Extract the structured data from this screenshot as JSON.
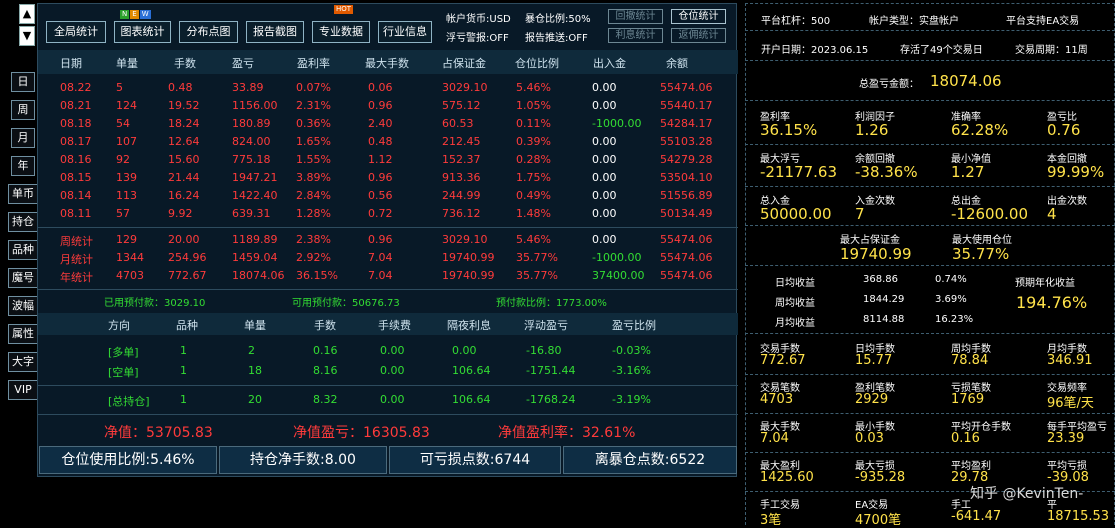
{
  "nav": {
    "up": "▲",
    "down": "▼"
  },
  "side_buttons": [
    "日",
    "周",
    "月",
    "年",
    "单币",
    "持仓",
    "品种",
    "魔号",
    "波幅",
    "属性",
    "大字",
    "VIP"
  ],
  "toolbar": {
    "buttons": [
      "全局统计",
      "图表统计",
      "分布点图",
      "报告截图",
      "专业数据",
      "行业信息"
    ],
    "badges": {
      "new": [
        "N",
        "E",
        "W"
      ],
      "hot": "HOT"
    },
    "account_currency": "帐户货币:USD",
    "exposure_ratio": "暴仓比例:50%",
    "loss_warning": "浮亏警报:OFF",
    "report_push": "报告推送:OFF",
    "small_buttons": [
      "回撤统计",
      "仓位统计",
      "利息统计",
      "返佣统计"
    ],
    "active_small": "仓位统计"
  },
  "table": {
    "headers": [
      "日期",
      "单量",
      "手数",
      "盈亏",
      "盈利率",
      "最大手数",
      "占保证金",
      "仓位比例",
      "出入金",
      "余额"
    ],
    "rows": [
      [
        "08.22",
        "5",
        "0.48",
        "33.89",
        "0.07%",
        "0.06",
        "3029.10",
        "5.46%",
        "0.00",
        "55474.06"
      ],
      [
        "08.21",
        "124",
        "19.52",
        "1156.00",
        "2.31%",
        "0.96",
        "575.12",
        "1.05%",
        "0.00",
        "55440.17"
      ],
      [
        "08.18",
        "54",
        "18.24",
        "180.89",
        "0.36%",
        "2.40",
        "60.53",
        "0.11%",
        "-1000.00",
        "54284.17"
      ],
      [
        "08.17",
        "107",
        "12.64",
        "824.00",
        "1.65%",
        "0.48",
        "212.45",
        "0.39%",
        "0.00",
        "55103.28"
      ],
      [
        "08.16",
        "92",
        "15.60",
        "775.18",
        "1.55%",
        "1.12",
        "152.37",
        "0.28%",
        "0.00",
        "54279.28"
      ],
      [
        "08.15",
        "139",
        "21.44",
        "1947.21",
        "3.89%",
        "0.96",
        "913.36",
        "1.75%",
        "0.00",
        "53504.10"
      ],
      [
        "08.14",
        "113",
        "16.24",
        "1422.40",
        "2.84%",
        "0.56",
        "244.99",
        "0.49%",
        "0.00",
        "51556.89"
      ],
      [
        "08.11",
        "57",
        "9.92",
        "639.31",
        "1.28%",
        "0.72",
        "736.12",
        "1.48%",
        "0.00",
        "50134.49"
      ]
    ],
    "summary": [
      [
        "周统计",
        "129",
        "20.00",
        "1189.89",
        "2.38%",
        "0.96",
        "3029.10",
        "5.46%",
        "0.00",
        "55474.06"
      ],
      [
        "月统计",
        "1344",
        "254.96",
        "1459.04",
        "2.92%",
        "7.04",
        "19740.99",
        "35.77%",
        "-1000.00",
        "55474.06"
      ],
      [
        "年统计",
        "4703",
        "772.67",
        "18074.06",
        "36.15%",
        "7.04",
        "19740.99",
        "35.77%",
        "37400.00",
        "55474.06"
      ]
    ]
  },
  "prepay": {
    "used": "已用预付款：3029.10",
    "available": "可用预付款：50676.73",
    "ratio": "预付款比例：1773.00%"
  },
  "positions": {
    "headers": [
      "方向",
      "品种",
      "单量",
      "手数",
      "手续费",
      "隔夜利息",
      "浮动盈亏",
      "盈亏比例"
    ],
    "rows": [
      [
        "[多单]",
        "1",
        "2",
        "0.16",
        "0.00",
        "0.00",
        "-16.80",
        "-0.03%"
      ],
      [
        "[空单]",
        "1",
        "18",
        "8.16",
        "0.00",
        "106.64",
        "-1751.44",
        "-3.16%"
      ]
    ],
    "total": [
      "[总持仓]",
      "1",
      "20",
      "8.32",
      "0.00",
      "106.64",
      "-1768.24",
      "-3.19%"
    ]
  },
  "net": {
    "value": "净值：53705.83",
    "pl": "净值盈亏：16305.83",
    "rate": "净值盈利率：32.61%"
  },
  "bottom_stats": [
    "仓位使用比例:5.46%",
    "持仓净手数:8.00",
    "可亏损点数:6744",
    "离暴仓点数:6522"
  ],
  "right": {
    "leverage": "平台杠杆：500",
    "account_type": "帐户类型：实盘帐户",
    "ea_support": "平台支持EA交易",
    "open_date": "开户日期：2023.06.15",
    "days": "存活了49个交易日",
    "cycle": "交易周期：11周",
    "total_pl_label": "总盈亏金额：",
    "total_pl_value": "18074.06",
    "grid1": [
      {
        "label": "盈利率",
        "value": "36.15%"
      },
      {
        "label": "利润因子",
        "value": "1.26"
      },
      {
        "label": "准确率",
        "value": "62.28%"
      },
      {
        "label": "盈亏比",
        "value": "0.76"
      },
      {
        "label": "最大浮亏",
        "value": "-21177.63"
      },
      {
        "label": "余额回撤",
        "value": "-38.36%"
      },
      {
        "label": "最小净值",
        "value": "1.27"
      },
      {
        "label": "本金回撤",
        "value": "99.99%"
      },
      {
        "label": "总入金",
        "value": "50000.00"
      },
      {
        "label": "入金次数",
        "value": "7"
      },
      {
        "label": "总出金",
        "value": "-12600.00"
      },
      {
        "label": "出金次数",
        "value": "4"
      }
    ],
    "max_margin_label": "最大占保证金",
    "max_margin_value": "19740.99",
    "max_pos_label": "最大使用仓位",
    "max_pos_value": "35.77%",
    "avg": [
      {
        "label": "日均收益",
        "amount": "368.86",
        "pct": "0.74%"
      },
      {
        "label": "周均收益",
        "amount": "1844.29",
        "pct": "3.69%"
      },
      {
        "label": "月均收益",
        "amount": "8114.88",
        "pct": "16.23%"
      }
    ],
    "annual_label": "预期年化收益",
    "annual_value": "194.76%",
    "grid2": [
      {
        "label": "交易手数",
        "value": "772.67"
      },
      {
        "label": "日均手数",
        "value": "15.77"
      },
      {
        "label": "周均手数",
        "value": "78.84"
      },
      {
        "label": "月均手数",
        "value": "346.91"
      },
      {
        "label": "交易笔数",
        "value": "4703"
      },
      {
        "label": "盈利笔数",
        "value": "2929"
      },
      {
        "label": "亏损笔数",
        "value": "1769"
      },
      {
        "label": "交易频率",
        "value": "96笔/天"
      },
      {
        "label": "最大手数",
        "value": "7.04"
      },
      {
        "label": "最小手数",
        "value": "0.03"
      },
      {
        "label": "平均开仓手数",
        "value": "0.16"
      },
      {
        "label": "每手平均盈亏",
        "value": "23.39"
      },
      {
        "label": "最大盈利",
        "value": "1425.60"
      },
      {
        "label": "最大亏损",
        "value": "-935.28"
      },
      {
        "label": "平均盈利",
        "value": "29.78"
      },
      {
        "label": "平均亏损",
        "value": "-39.08"
      },
      {
        "label": "手工交易",
        "value": "3笔"
      },
      {
        "label": "EA交易",
        "value": "4700笔"
      },
      {
        "label": "手工",
        "value": "-641.47"
      },
      {
        "label": "平",
        "value": "18715.53"
      }
    ],
    "watermark": "知乎 @KevinTen-"
  }
}
